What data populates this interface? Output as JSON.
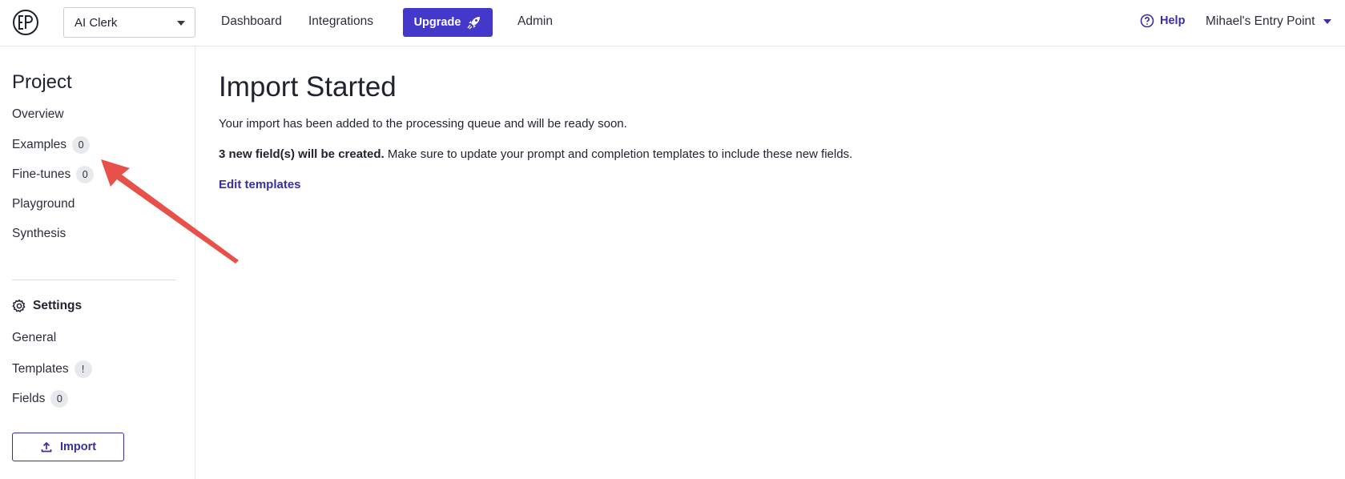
{
  "header": {
    "project_select": "AI Clerk",
    "nav": [
      "Dashboard",
      "Integrations",
      "Admin"
    ],
    "upgrade_label": "Upgrade",
    "help_label": "Help",
    "user_label": "Mihael's Entry Point",
    "accent_color": "#4338ca"
  },
  "sidebar": {
    "title": "Project",
    "items": [
      {
        "label": "Overview"
      },
      {
        "label": "Examples",
        "badge": "0"
      },
      {
        "label": "Fine-tunes",
        "badge": "0"
      },
      {
        "label": "Playground"
      },
      {
        "label": "Synthesis"
      }
    ],
    "settings_label": "Settings",
    "settings_items": [
      {
        "label": "General"
      },
      {
        "label": "Templates",
        "badge": "!"
      },
      {
        "label": "Fields",
        "badge": "0"
      }
    ],
    "import_label": "Import"
  },
  "main": {
    "title": "Import Started",
    "message": "Your import has been added to the processing queue and will be ready soon.",
    "fields_bold": "3 new field(s) will be created.",
    "fields_rest": " Make sure to update your prompt and completion templates to include these new fields.",
    "edit_link": "Edit templates"
  },
  "annotation": {
    "arrow_color": "#e8504a",
    "icon": "red-arrow-icon"
  }
}
